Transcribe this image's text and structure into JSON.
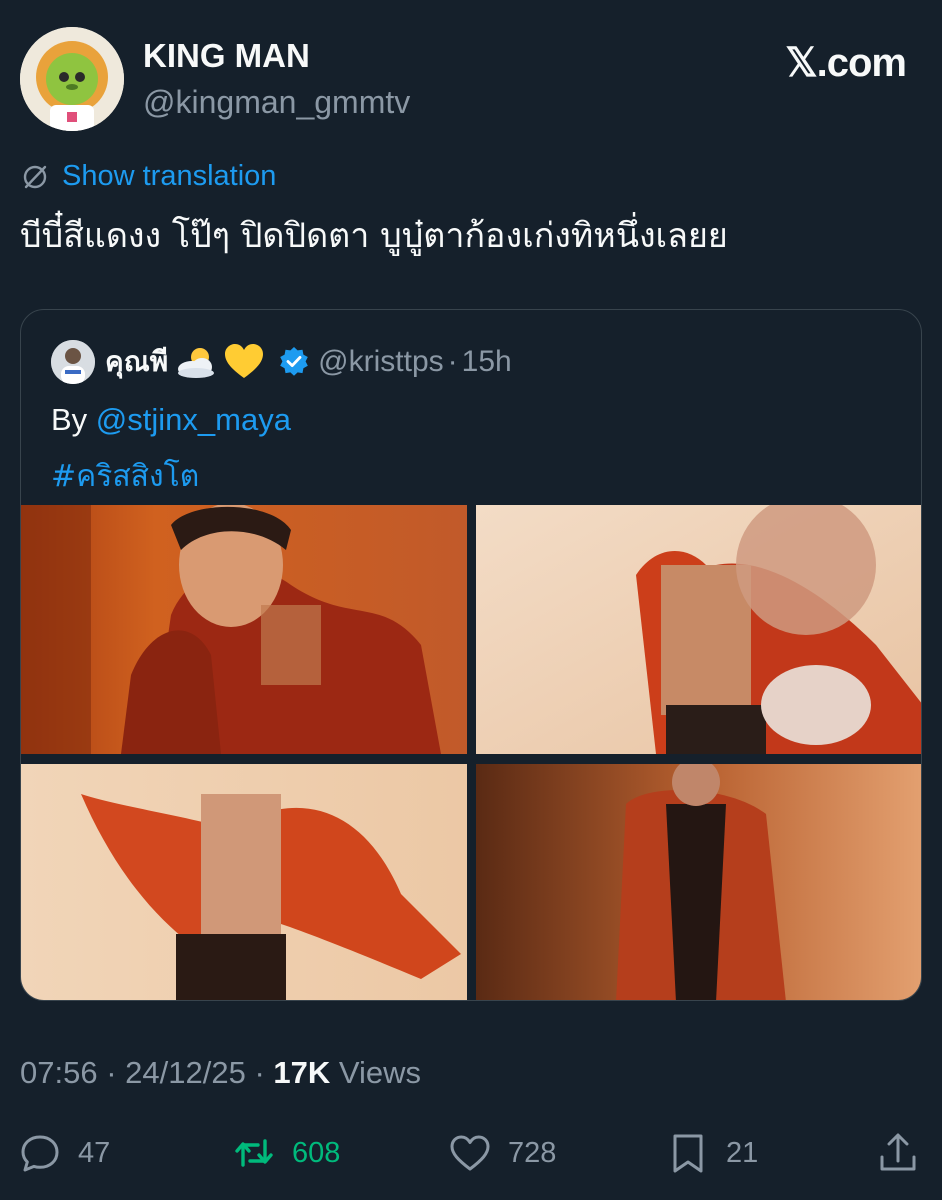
{
  "author": {
    "name": "KING MAN",
    "handle": "@kingman_gmmtv"
  },
  "site_logo": "𝕏.com",
  "translate": {
    "label": "Show translation"
  },
  "tweet_text": "บีบี๋สีแดงง โป๊ๆ ปิดปิดตา บูบู๋ตาก้องเก่งทิหนึ่งเลยย",
  "quote": {
    "name": "คุณพี",
    "emojis": [
      "sun-behind-cloud",
      "yellow-heart"
    ],
    "verified": true,
    "handle": "@kristtps",
    "separator": "·",
    "time": "15h",
    "text_prefix": "By ",
    "mention": "@stjinx_maya",
    "hashtag": "#คริสสิงโต",
    "photos": [
      {
        "name": "photo-1"
      },
      {
        "name": "photo-2"
      },
      {
        "name": "photo-3"
      },
      {
        "name": "photo-4"
      }
    ]
  },
  "meta": {
    "time": "07:56",
    "date": "24/12/25",
    "separator": "·",
    "views_count": "17K",
    "views_label": "Views"
  },
  "actions": {
    "replies": "47",
    "retweets": "608",
    "likes": "728",
    "bookmarks": "21"
  },
  "colors": {
    "background": "#15202b",
    "accent": "#1d9bf0",
    "retweet": "#00ba7c",
    "muted": "#8b98a5"
  },
  "icons": [
    "translate-icon",
    "verified-badge-icon",
    "reply-icon",
    "retweet-icon",
    "like-icon",
    "bookmark-icon",
    "share-icon"
  ]
}
